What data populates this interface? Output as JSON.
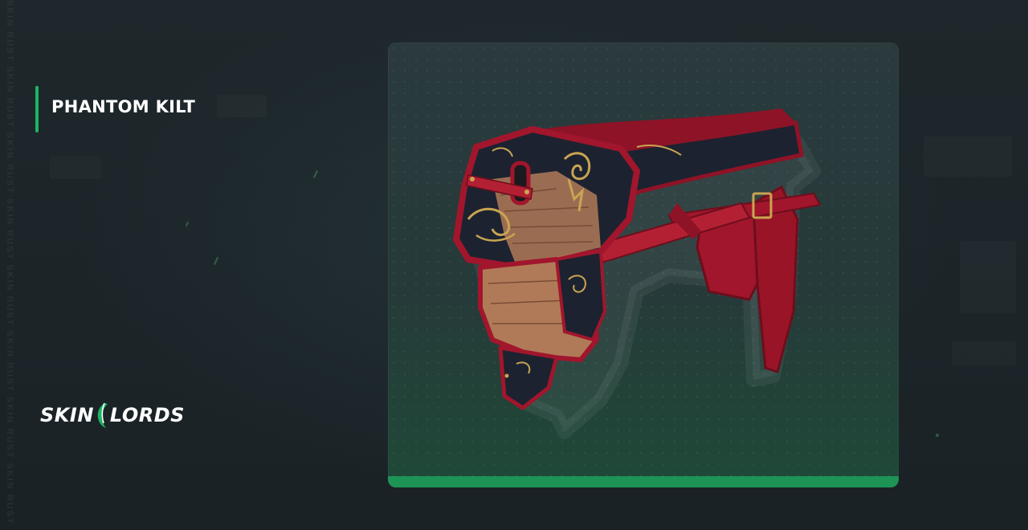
{
  "watermark": {
    "text": "SKIN RUST SKIN RUST SKIN RUST SKIN RUST SKIN RUST SKIN RUST SKIN RUST SKIN RUST"
  },
  "item": {
    "name": "PHANTOM KILT"
  },
  "logo": {
    "left": "SKIN",
    "right": "LORDS"
  },
  "colors": {
    "accent": "#1fb464",
    "card_bar": "#1e9356",
    "kilt_red": "#a1162c",
    "kilt_navy": "#1c2230",
    "kilt_gold": "#c9a452",
    "kilt_leather": "#b07a58"
  },
  "icons": {
    "logo_leaf": "leaf-icon",
    "item": "kilt-item-icon"
  }
}
